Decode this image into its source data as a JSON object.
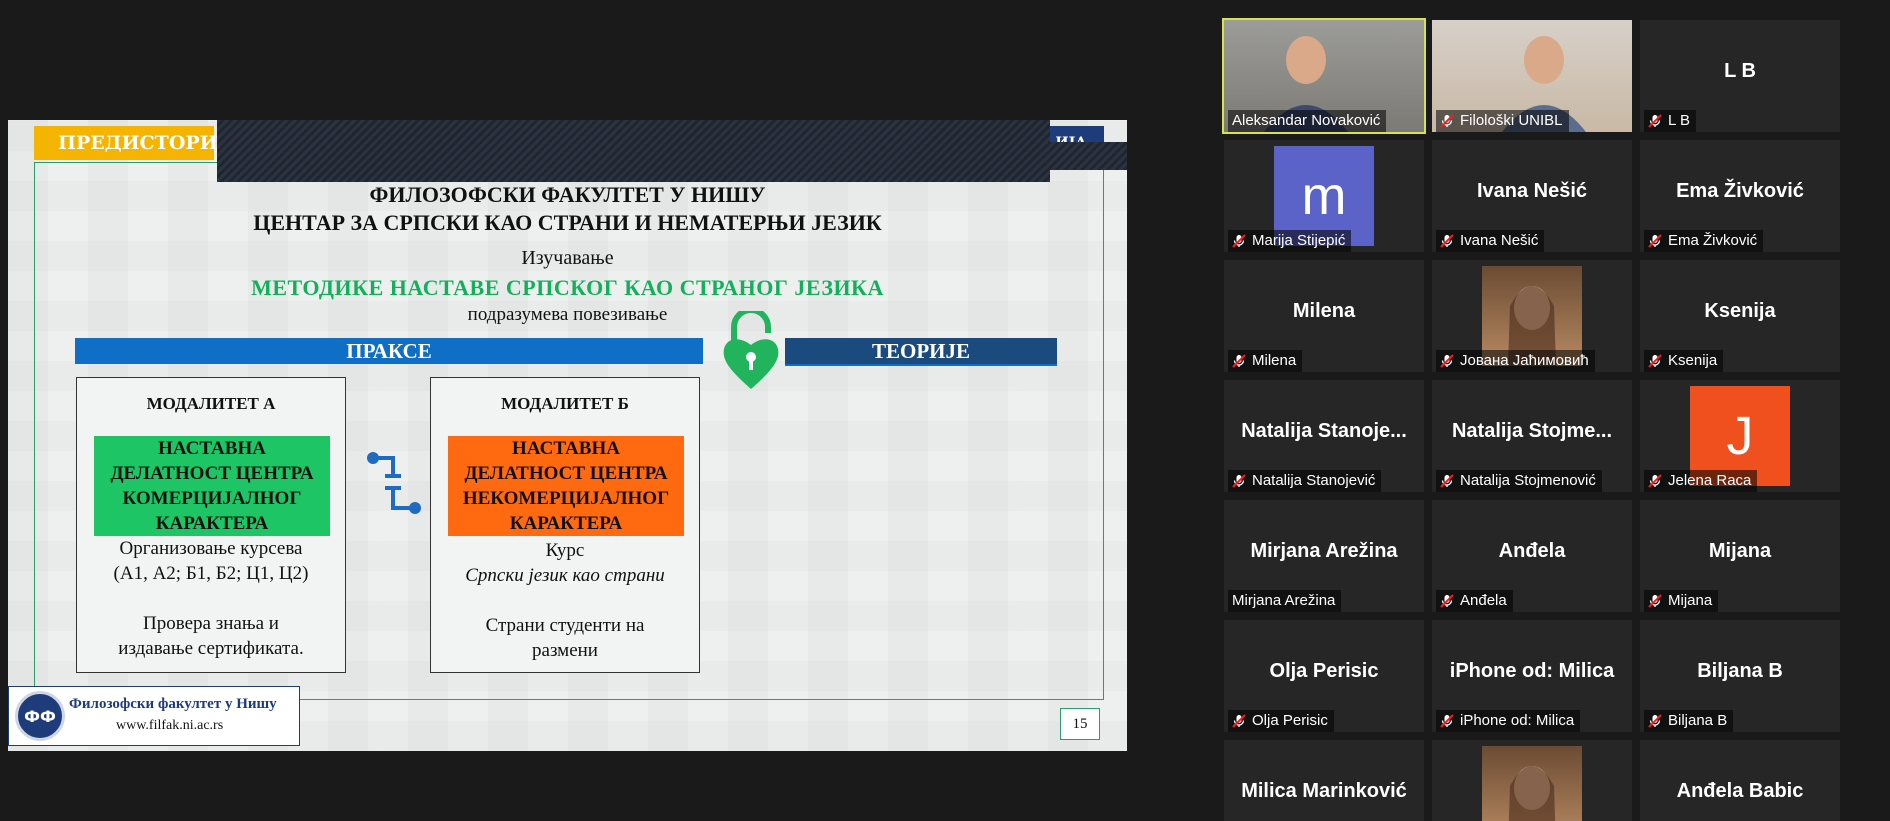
{
  "slide": {
    "tag_left": "ПРЕДИСТОРИЈА",
    "tag_right": "ИЈА",
    "title1": "ФИЛОЗОФСКИ ФАКУЛТЕТ У НИШУ",
    "title2": "ЦЕНТАР ЗА СРПСКИ КАО СТРАНИ И НЕМАТЕРЊИ ЈЕЗИК",
    "line3": "Изучавање",
    "line4": "МЕТОДИКЕ НАСТАВЕ СРПСКОГ КАО СТРАНОГ ЈЕЗИКА",
    "line5": "подразумева повезивање",
    "band_left": "ПРАКСЕ",
    "band_right": "ТЕОРИЈЕ",
    "box_a": {
      "title": "МОДАЛИТЕТ А",
      "highlight": "НАСТАВНА ДЕЛАТНОСТ ЦЕНТРА КОМЕРЦИЈАЛНОГ КАРАКТЕРА",
      "line1": "Организовање курсева",
      "line2": "(А1, А2; Б1, Б2; Ц1, Ц2)",
      "line3": "Провера знања и",
      "line4": "издавање сертификата."
    },
    "box_b": {
      "title": "МОДАЛИТЕТ Б",
      "highlight": "НАСТАВНА ДЕЛАТНОСТ ЦЕНТРА НЕКОМЕРЦИЈАЛНОГ КАРАКТЕРА",
      "line1": "Курс",
      "line2": "Српски језик као страни",
      "line3": "Страни студенти на",
      "line4": "размени"
    },
    "footer_name": "Филозофски факултет у Нишу",
    "footer_url": "www.filfak.ni.ac.rs",
    "page_number": "15"
  },
  "colors": {
    "accent_green": "#12b05a",
    "band_blue": "#0f6fc6",
    "band_dark": "#1b4a7e",
    "active_speaker": "#d6e34a"
  },
  "participants": [
    {
      "label": "Aleksandar Novaković",
      "muted": false,
      "kind": "video",
      "active": true
    },
    {
      "label": "Filološki UNIBL",
      "muted": true,
      "kind": "video"
    },
    {
      "big": "L B",
      "label": "L B",
      "muted": true,
      "kind": "name"
    },
    {
      "avatar": "m",
      "label": "Marija Stijepić",
      "muted": true,
      "kind": "avatar",
      "avatar_color": "#5b63c8"
    },
    {
      "big": "Ivana Nešić",
      "label": "Ivana Nešić",
      "muted": true,
      "kind": "name"
    },
    {
      "big": "Ema Živković",
      "label": "Ema Živković",
      "muted": true,
      "kind": "name"
    },
    {
      "big": "Milena",
      "label": "Milena",
      "muted": true,
      "kind": "name"
    },
    {
      "label": "Јована Јаћимовић",
      "muted": true,
      "kind": "photo"
    },
    {
      "big": "Ksenija",
      "label": "Ksenija",
      "muted": true,
      "kind": "name"
    },
    {
      "big": "Natalija  Stanoje...",
      "label": "Natalija Stanojević",
      "muted": true,
      "kind": "name"
    },
    {
      "big": "Natalija  Stojme...",
      "label": "Natalija Stojmenović",
      "muted": true,
      "kind": "name"
    },
    {
      "avatar": "J",
      "label": "Jelena Raca",
      "muted": true,
      "kind": "avatar",
      "avatar_color": "#f0501e"
    },
    {
      "big": "Mirjana Arežina",
      "label": "Mirjana Arežina",
      "muted": false,
      "kind": "name"
    },
    {
      "big": "Anđela",
      "label": "Anđela",
      "muted": true,
      "kind": "name"
    },
    {
      "big": "Mijana",
      "label": "Mijana",
      "muted": true,
      "kind": "name"
    },
    {
      "big": "Olja Perisic",
      "label": "Olja Perisic",
      "muted": true,
      "kind": "name"
    },
    {
      "big": "iPhone od: Milica",
      "label": "iPhone od: Milica",
      "muted": true,
      "kind": "name"
    },
    {
      "big": "Biljana B",
      "label": "Biljana B",
      "muted": true,
      "kind": "name"
    },
    {
      "big": "Milica Marinković",
      "kind": "name_cut"
    },
    {
      "kind": "photo_cut"
    },
    {
      "big": "Anđela Babic",
      "kind": "name_cut"
    }
  ]
}
